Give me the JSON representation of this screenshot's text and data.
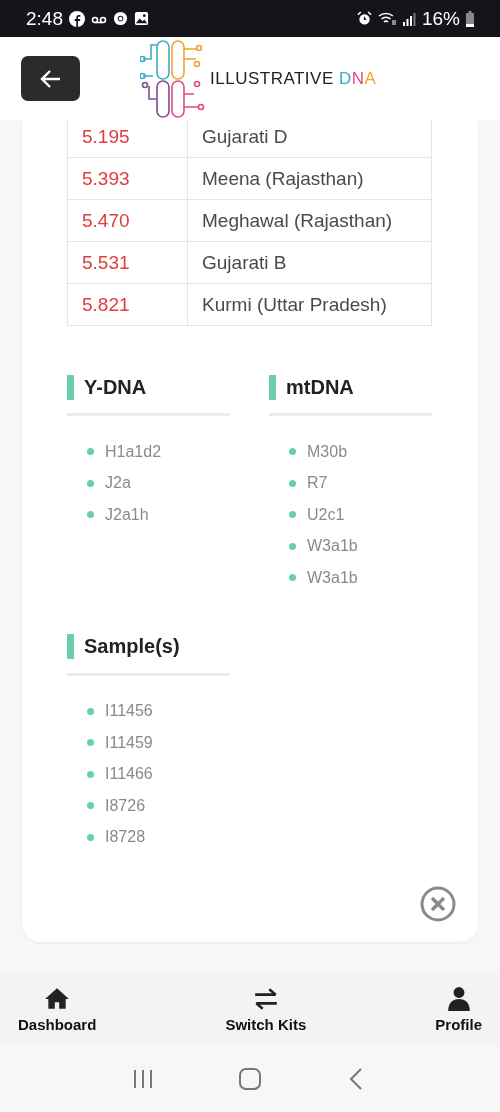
{
  "status_bar": {
    "time": "2:48",
    "battery": "16%"
  },
  "header": {
    "logo_text": "ILLUSTRATIVE",
    "logo_accent": "DNA"
  },
  "table": {
    "rows": [
      {
        "distance": "5.195",
        "population": "Gujarati D"
      },
      {
        "distance": "5.393",
        "population": "Meena (Rajasthan)"
      },
      {
        "distance": "5.470",
        "population": "Meghawal (Rajasthan)"
      },
      {
        "distance": "5.531",
        "population": "Gujarati B"
      },
      {
        "distance": "5.821",
        "population": "Kurmi (Uttar Pradesh)"
      }
    ]
  },
  "sections": [
    {
      "title": "Y-DNA",
      "items": [
        "H1a1d2",
        "J2a",
        "J2a1h"
      ]
    },
    {
      "title": "mtDNA",
      "items": [
        "M30b",
        "R7",
        "U2c1",
        "W3a1b",
        "W3a1b"
      ]
    },
    {
      "title": "Sample(s)",
      "items": [
        "I11456",
        "I11459",
        "I11466",
        "I8726",
        "I8728"
      ]
    }
  ],
  "bottom_nav": [
    {
      "kind": "home",
      "label": "Dashboard"
    },
    {
      "kind": "switch",
      "label": "Switch Kits"
    },
    {
      "kind": "profile",
      "label": "Profile"
    }
  ]
}
